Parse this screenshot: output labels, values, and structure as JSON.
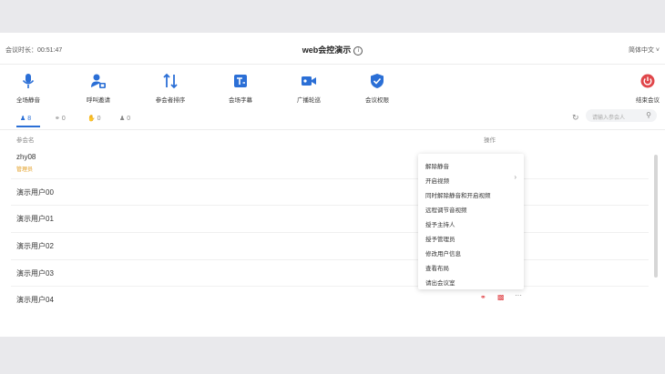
{
  "header": {
    "duration": "会议时长：00:51:47",
    "title": "web会控演示",
    "language": "简体中文 ˅"
  },
  "toolbar": [
    {
      "label": "全场静音",
      "icon": "microphone-icon"
    },
    {
      "label": "呼叫邀请",
      "icon": "invite-user-icon"
    },
    {
      "label": "参会者排序",
      "icon": "sort-icon"
    },
    {
      "label": "会场字幕",
      "icon": "subtitle-icon"
    },
    {
      "label": "广播轮巡",
      "icon": "broadcast-video-icon"
    },
    {
      "label": "会议权限",
      "icon": "shield-icon"
    },
    {
      "label": "结束会议",
      "icon": "power-icon"
    }
  ],
  "tabs": [
    {
      "count": "8",
      "icon": "participants-icon"
    },
    {
      "count": "0",
      "icon": "microphone-icon"
    },
    {
      "count": "0",
      "icon": "hand-raise-icon"
    },
    {
      "count": "0",
      "icon": "user-icon"
    }
  ],
  "search": {
    "placeholder": "请输入参会人"
  },
  "columns": {
    "name": "参会名",
    "actions": "操作"
  },
  "participants": [
    {
      "name": "zhy08",
      "role": "管理员"
    },
    {
      "name": "演示用户00",
      "role": ""
    },
    {
      "name": "演示用户01",
      "role": ""
    },
    {
      "name": "演示用户02",
      "role": ""
    },
    {
      "name": "演示用户03",
      "role": ""
    },
    {
      "name": "演示用户04",
      "role": ""
    }
  ],
  "context_menu": [
    {
      "label": "解除静音",
      "has_submenu": false
    },
    {
      "label": "开启视频",
      "has_submenu": true
    },
    {
      "label": "同时解除静音和开启视频",
      "has_submenu": false
    },
    {
      "label": "远程调节音视频",
      "has_submenu": false
    },
    {
      "label": "授予主持人",
      "has_submenu": false
    },
    {
      "label": "授予管理员",
      "has_submenu": false
    },
    {
      "label": "修改用户信息",
      "has_submenu": false
    },
    {
      "label": "查看布局",
      "has_submenu": false
    },
    {
      "label": "请出会议室",
      "has_submenu": false
    }
  ],
  "row_actions": {
    "more": "···"
  },
  "colors": {
    "accent": "#2b6fd6",
    "danger": "#e0464a",
    "admin": "#e19b1c"
  }
}
